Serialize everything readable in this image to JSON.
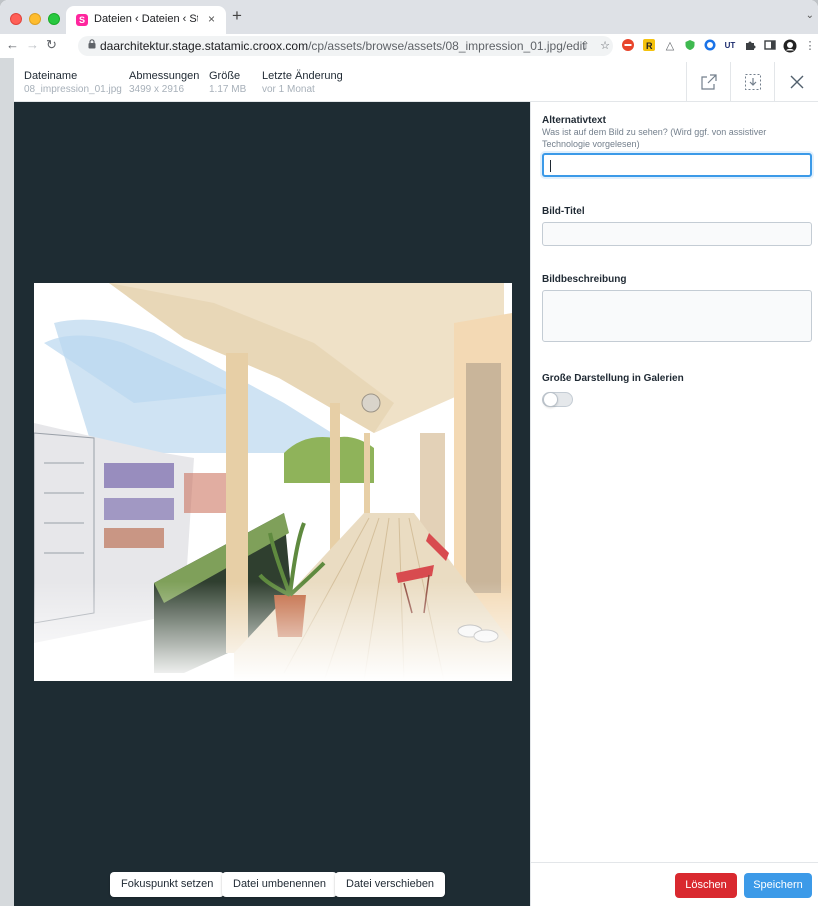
{
  "browser": {
    "tab_title": "Dateien ‹ Dateien ‹ Statamic",
    "tab_favicon": "S",
    "tab_close": "×",
    "new_tab": "+",
    "url_host": "daarchitektur.stage.statamic.croox.com",
    "url_path": "/cp/assets/browse/assets/08_impression_01.jpg/edit",
    "extension_icons": [
      "share-icon",
      "star-icon",
      "ext-red-icon",
      "ext-r-icon",
      "ext-cloud-icon",
      "ext-shield-icon",
      "ext-1password-icon",
      "ext-ut-icon",
      "puzzle-icon",
      "sidebar-icon",
      "profile-icon",
      "kebab-menu-icon"
    ]
  },
  "header": {
    "filename_label": "Dateiname",
    "filename_value": "08_impression_01.jpg",
    "dimensions_label": "Abmessungen",
    "dimensions_value": "3499 x 2916",
    "size_label": "Größe",
    "size_value": "1.17 MB",
    "modified_label": "Letzte Änderung",
    "modified_value": "vor 1 Monat"
  },
  "form": {
    "alt_label": "Alternativtext",
    "alt_help": "Was ist auf dem Bild zu sehen? (Wird ggf. von assistiver Technologie vorgelesen)",
    "alt_value": "",
    "title_label": "Bild-Titel",
    "title_value": "",
    "description_label": "Bildbeschreibung",
    "description_value": "",
    "gallery_label": "Große Darstellung in Galerien",
    "gallery_toggle": false
  },
  "actions": {
    "focus_point": "Fokuspunkt setzen",
    "rename": "Datei umbenennen",
    "move": "Datei verschieben",
    "delete": "Löschen",
    "save": "Speichern"
  },
  "colors": {
    "preview_bg": "#1e2c33",
    "danger": "#d9292f",
    "primary": "#3c9ae8"
  }
}
